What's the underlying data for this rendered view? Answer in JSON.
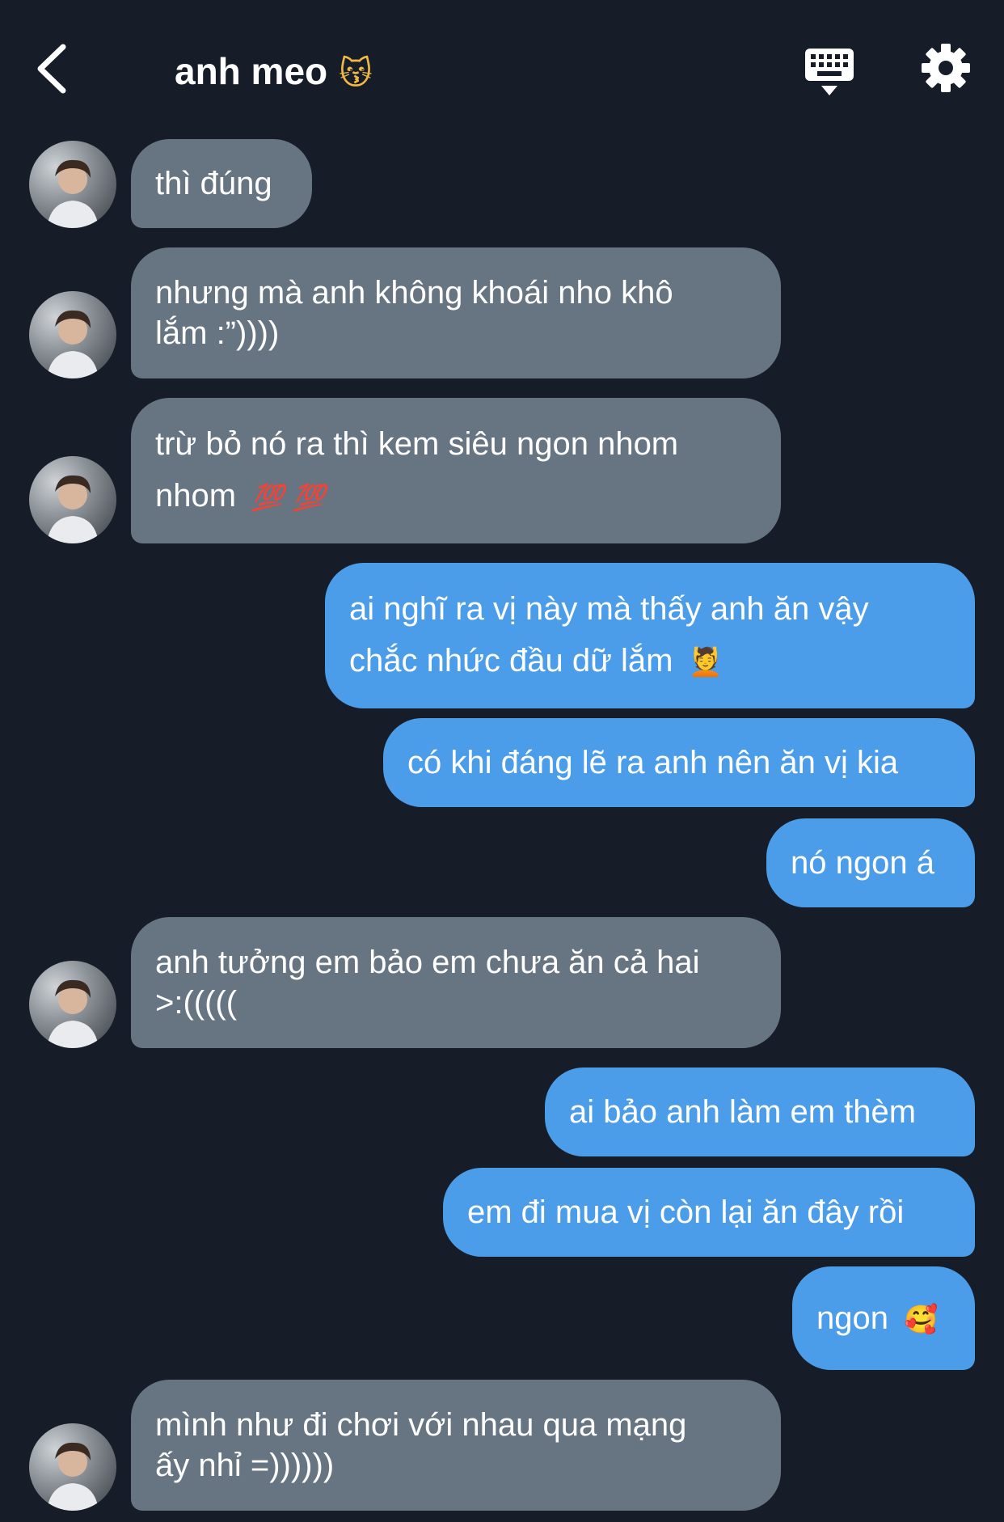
{
  "header": {
    "title": "anh meo",
    "title_emoji": "😽",
    "back_icon": "chevron-left-icon",
    "keyboard_icon": "keyboard-icon",
    "settings_icon": "gear-icon"
  },
  "colors": {
    "background": "#161d28",
    "incoming_bubble": "#677482",
    "outgoing_bubble": "#4b9de9",
    "text": "#ffffff"
  },
  "messages": [
    {
      "side": "in",
      "text": "thì đúng"
    },
    {
      "side": "in",
      "text": "nhưng mà anh không khoái nho khô\nlắm :”))))"
    },
    {
      "side": "in",
      "text": "trừ bỏ nó ra thì kem siêu ngon nhom\nnhom",
      "emoji": "💯 💯"
    },
    {
      "side": "out",
      "text": "ai nghĩ ra vị này mà thấy anh ăn vậy\nchắc nhức đầu dữ lắm",
      "emoji": "💆"
    },
    {
      "side": "out",
      "text": "có khi đáng lẽ ra anh nên ăn vị kia"
    },
    {
      "side": "out",
      "text": "nó ngon á"
    },
    {
      "side": "in",
      "text": "anh tưởng em bảo em chưa ăn cả hai\n>:((((("
    },
    {
      "side": "out",
      "text": "ai bảo anh làm em thèm"
    },
    {
      "side": "out",
      "text": "em đi mua vị còn lại ăn đây rồi"
    },
    {
      "side": "out",
      "text": "ngon",
      "emoji": "🥰"
    },
    {
      "side": "in",
      "text": "mình như đi chơi với nhau qua mạng\nấy nhỉ =))))))"
    }
  ]
}
